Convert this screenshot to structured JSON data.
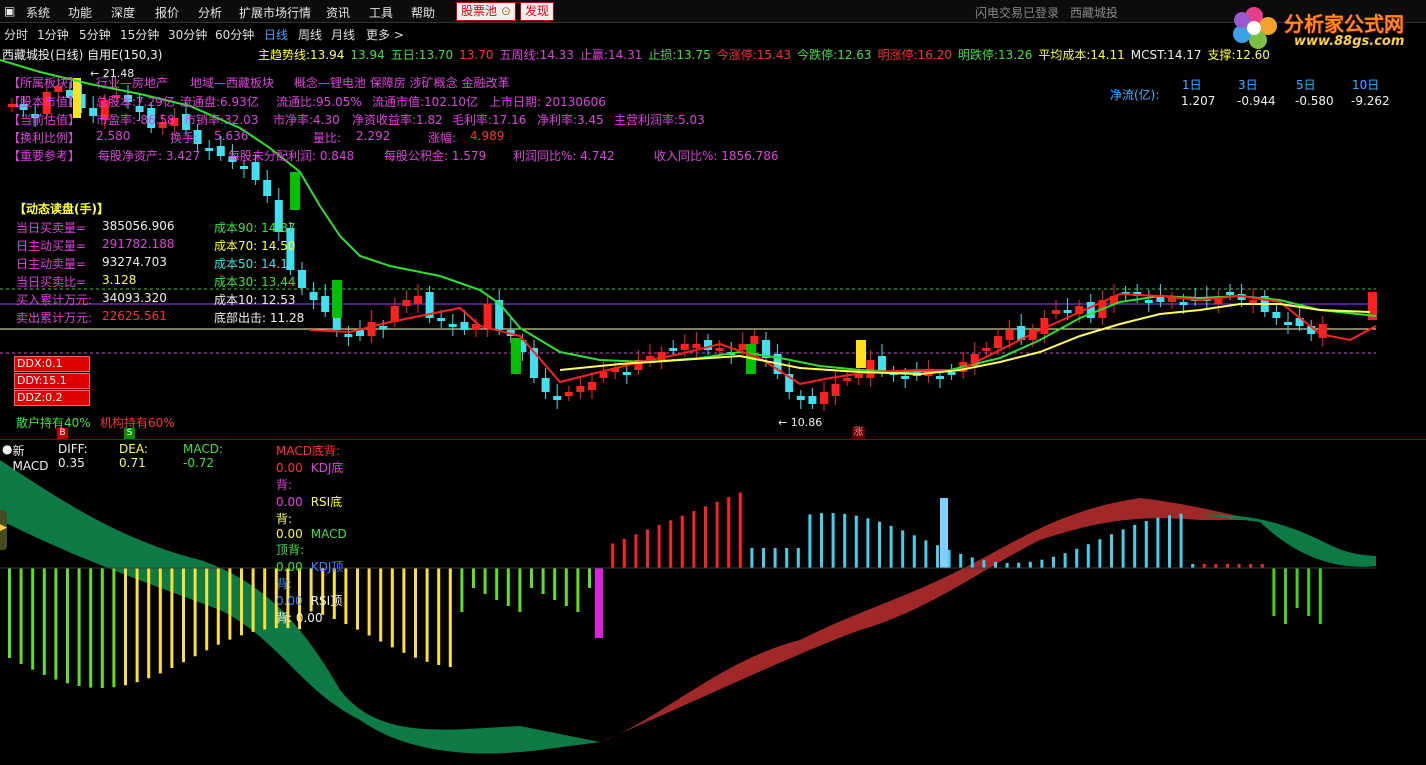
{
  "menu": {
    "items": [
      "系统",
      "功能",
      "深度",
      "报价",
      "分析",
      "扩展市场行情",
      "资讯",
      "工具",
      "帮助"
    ],
    "stock_pool": "股票池",
    "discover": "发现",
    "status": "闪电交易已登录",
    "stock_title": "西藏城投"
  },
  "periods": [
    "分时",
    "1分钟",
    "5分钟",
    "15分钟",
    "30分钟",
    "60分钟",
    "日线",
    "周线",
    "月线",
    "更多"
  ],
  "active_period": "日线",
  "logo": {
    "text": "分析家公式网",
    "url": "www.88gs.com"
  },
  "infoline": {
    "name": "西藏城投(日线) 自用E(150,3)",
    "items": [
      {
        "label": "主趋势线:",
        "value": "13.94",
        "color": "#ffff40"
      },
      {
        "label": "",
        "value": "13.94",
        "color": "#40e040"
      },
      {
        "label": "五日:",
        "value": "13.70",
        "color": "#40e040"
      },
      {
        "label": "",
        "value": "13.70",
        "color": "#ff3030"
      },
      {
        "label": "五周线:",
        "value": "14.33",
        "color": "#e040e0"
      },
      {
        "label": "止赢:",
        "value": "14.31",
        "color": "#e040e0"
      },
      {
        "label": "止损:",
        "value": "13.75",
        "color": "#40e040"
      },
      {
        "label": "今涨停:",
        "value": "15.43",
        "color": "#ff3030"
      },
      {
        "label": "今跌停:",
        "value": "12.63",
        "color": "#40e040"
      },
      {
        "label": "明涨停:",
        "value": "16.20",
        "color": "#ff3030"
      },
      {
        "label": "明跌停:",
        "value": "13.26",
        "color": "#40e040"
      },
      {
        "label": "平均成本:",
        "value": "14.11",
        "color": "#ffff40"
      },
      {
        "label": "MCST:",
        "value": "14.17",
        "color": "#f0f0f0"
      },
      {
        "label": "支撑:",
        "value": "12.60",
        "color": "#ffff40"
      }
    ]
  },
  "f10": {
    "r1": [
      "【所属板块】",
      "行业—房地产",
      "地域—西藏板块",
      "概念—锂电池 保障房 涉矿概念 金融改革"
    ],
    "r2": [
      "【股本市值】",
      "总股本:7.29亿",
      "流通盘:6.93亿",
      "流通比:95.05%",
      "流通市值:102.10亿",
      "上市日期: 20130606"
    ],
    "r3": [
      "【当前估值】",
      "市盈率:-86.58",
      "市销率:32.03",
      "市净率:4.30",
      "净资收益率:1.82",
      "毛利率:17.16",
      "净利率:3.45",
      "主营利润率:5.03"
    ],
    "r4": [
      "【换利比例】",
      "2.580",
      "换手:",
      "5.636",
      "量比:",
      "2.292",
      "涨幅:",
      "4.989"
    ],
    "r5": [
      "【重要参考】",
      "每股净资产: 3.427",
      "每股未分配利润: 0.848",
      "每股公积金: 1.579",
      "利润同比%: 4.742",
      "收入同比%: 1856.786"
    ]
  },
  "netflow": {
    "label": "净流(亿):",
    "headers": [
      "1日",
      "3日",
      "5日",
      "10日"
    ],
    "values": [
      "1.207",
      "-0.944",
      "-0.580",
      "-9.262"
    ]
  },
  "dynamic": {
    "title": "【动态读盘(手)】",
    "rows": [
      {
        "label": "当日买卖量=",
        "value": "385056.906"
      },
      {
        "label": "日主动买量=",
        "value": "291782.188"
      },
      {
        "label": "日主动卖量=",
        "value": "93274.703"
      },
      {
        "label": "当日买卖比=",
        "value": "3.128"
      },
      {
        "label": "买入累计万元:",
        "value": "34093.320"
      },
      {
        "label": "卖出累计万元:",
        "value": "22625.561"
      }
    ],
    "costs": [
      "成本90: 14.87",
      "成本70: 14.50",
      "成本50: 14.11",
      "成本30: 13.44",
      "成本10: 12.53",
      "底部出击: 11.28"
    ]
  },
  "ddx": [
    "DDX:0.1",
    "DDY:15.1",
    "DDZ:0.2"
  ],
  "holders": {
    "retail": "散户持有40%",
    "inst": "机构持有60%"
  },
  "price_marks": {
    "high": "21.48",
    "low": "10.86",
    "b": "B",
    "s": "S",
    "zhang": "涨"
  },
  "macd": {
    "title": "新MACD",
    "diff": "DIFF: 0.35",
    "dea": "DEA: 0.71",
    "macd": "MACD: -0.72",
    "flags": [
      {
        "label": "MACD底背:",
        "value": "0.00",
        "color": "#ff3030"
      },
      {
        "label": "KDJ底背:",
        "value": "0.00",
        "color": "#e040e0"
      },
      {
        "label": "RSI底背:",
        "value": "0.00",
        "color": "#ffff40"
      },
      {
        "label": "MACD顶背:",
        "value": "0.00",
        "color": "#40e040"
      },
      {
        "label": "KDJ顶背:",
        "value": "0.00",
        "color": "#4080ff"
      },
      {
        "label": "RSI顶背:",
        "value": "0.00",
        "color": "#f0f0f0"
      }
    ]
  },
  "colors": {
    "up": "#ff2020",
    "down": "#40e0f0",
    "bg": "#000000",
    "ma_green": "#30e030",
    "ma_red": "#ff2020",
    "ma_yellow": "#ffff60"
  }
}
